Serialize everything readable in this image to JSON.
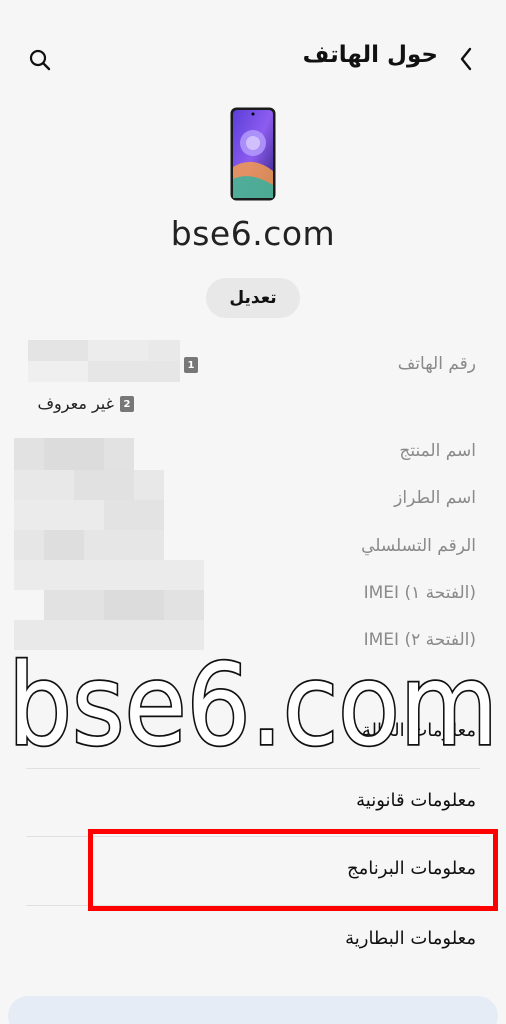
{
  "header": {
    "title": "حول الهاتف",
    "back_icon": "chevron-left-icon",
    "search_icon": "search-icon"
  },
  "device": {
    "name": "bse6.com",
    "edit_label": "تعديل"
  },
  "info_rows": {
    "phone_number_label": "رقم الهاتف",
    "sim1_badge": "1",
    "sim2_badge": "2",
    "sim2_value": "غير معروف",
    "product_name_label": "اسم المنتج",
    "model_name_label": "اسم الطراز",
    "serial_number_label": "الرقم التسلسلي",
    "imei1_label": "IMEI (الفتحة ١)",
    "imei2_label": "IMEI (الفتحة ٢)"
  },
  "watermark": "bse6.com",
  "menu": {
    "status_info": "معلومات الحالة",
    "legal_info": "معلومات قانونية",
    "software_info": "معلومات البرنامج",
    "battery_info": "معلومات البطارية"
  },
  "colors": {
    "background": "#f6f6f6",
    "highlight": "#ff0000",
    "label_gray": "#8a8a8a"
  }
}
